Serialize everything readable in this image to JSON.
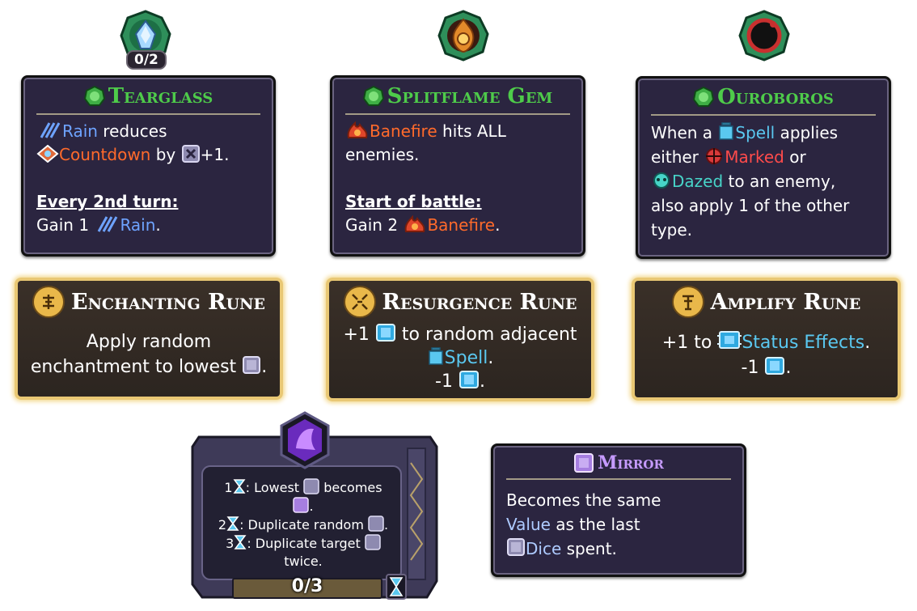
{
  "relics": [
    {
      "title": "Tearglass",
      "icon": "tearglass-icon",
      "counter": "0/2",
      "lines": {
        "l1_kw": "Rain",
        "l1_rest": " reduces",
        "l2_kw": "Countdown",
        "l2_mid": " by ",
        "l2_end": "+1.",
        "heading": "Every 2nd turn:",
        "l3_pre": "Gain 1 ",
        "l3_kw": "Rain",
        "l3_end": "."
      }
    },
    {
      "title": "Splitflame Gem",
      "icon": "splitflame-icon",
      "lines": {
        "l1_kw": "Banefire",
        "l1_rest": " hits ALL",
        "l2": "enemies.",
        "heading": "Start of battle:",
        "l3_pre": "Gain 2 ",
        "l3_kw": "Banefire",
        "l3_end": "."
      }
    },
    {
      "title": "Ouroboros",
      "icon": "ouroboros-icon",
      "lines": {
        "l1_pre": "When a ",
        "l1_kw": "Spell",
        "l1_rest": " applies",
        "l2_pre": "either ",
        "l2_kw": "Marked",
        "l2_rest": " or",
        "l3_kw": "Dazed",
        "l3_rest": " to an enemy,",
        "l4": "also apply 1 of the other",
        "l5": "type."
      }
    }
  ],
  "runes": [
    {
      "title": "Enchanting Rune",
      "icon": "enchanting-rune-icon",
      "line1": "Apply random",
      "line2": "enchantment to lowest",
      "line2_end": "."
    },
    {
      "title": "Resurgence Rune",
      "icon": "resurgence-rune-icon",
      "line1_pre": "+1 ",
      "line1_rest": " to random adjacent",
      "line2_kw": "Spell",
      "line2_end": ".",
      "line3_pre": "-1 ",
      "line3_end": "."
    },
    {
      "title": "Amplify Rune",
      "icon": "amplify-rune-icon",
      "line1_pre": "+1 to ",
      "line1_kw": "Status Effects",
      "line1_end": ".",
      "line2_pre": "-1 ",
      "line2_end": "."
    }
  ],
  "die_panel": {
    "rows": [
      {
        "num": "1",
        "text": ": Lowest ",
        "text2": " becomes",
        "text3": "."
      },
      {
        "num": "2",
        "text": ": Duplicate random ",
        "text3": "."
      },
      {
        "num": "3",
        "text": ": Duplicate target ",
        "text2": "twice."
      }
    ],
    "counter": "0/3"
  },
  "mirror": {
    "title": "Mirror",
    "line1": "Becomes the same",
    "line2_kw": "Value",
    "line2_rest": " as the last",
    "line3_kw": "Dice",
    "line3_rest": " spent."
  },
  "colors": {
    "title_green": "#4ecb4a",
    "rain_blue": "#6ea3ff",
    "fire_orange": "#ff6a2b",
    "marked_red": "#ff4b4b",
    "dazed_teal": "#47d4c8",
    "rune_gold": "#e9c874",
    "mirror_purple": "#c69bff"
  }
}
